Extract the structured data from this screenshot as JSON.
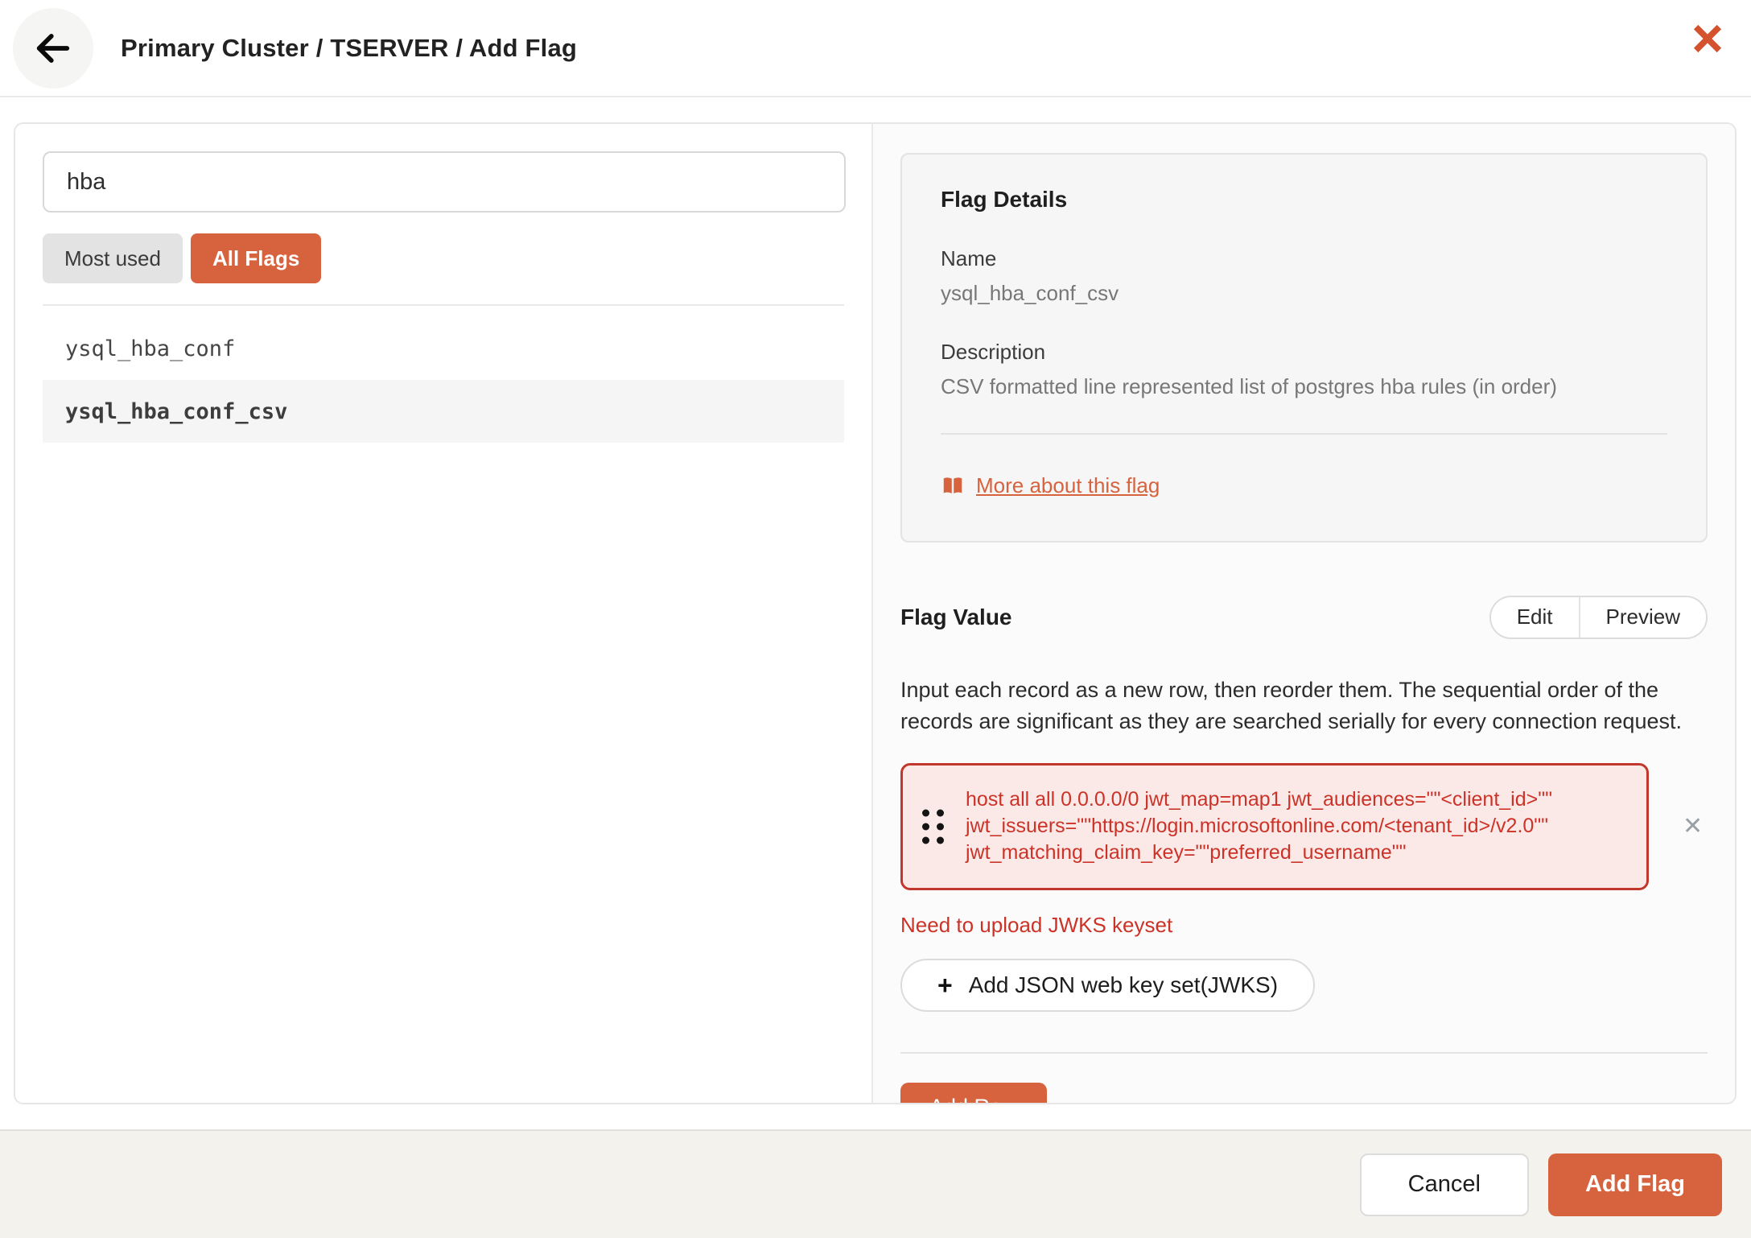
{
  "header": {
    "title": "Primary Cluster / TSERVER / Add Flag"
  },
  "search": {
    "value": "hba"
  },
  "filters": {
    "most_used_label": "Most used",
    "all_flags_label": "All Flags"
  },
  "flag_list": [
    {
      "name": "ysql_hba_conf",
      "selected": false
    },
    {
      "name": "ysql_hba_conf_csv",
      "selected": true
    }
  ],
  "flag_details": {
    "title": "Flag Details",
    "name_label": "Name",
    "name_value": "ysql_hba_conf_csv",
    "description_label": "Description",
    "description_value": "CSV formatted line represented list of postgres hba rules (in order)",
    "more_link_label": "More about this flag"
  },
  "flag_value": {
    "title": "Flag Value",
    "edit_label": "Edit",
    "preview_label": "Preview",
    "instructions": "Input each record as a new row, then reorder them. The sequential order of the records are significant as they are searched serially for every connection request.",
    "row_value": "host all all 0.0.0.0/0 jwt_map=map1 jwt_audiences=\"\"<client_id>\"\" jwt_issuers=\"\"https://login.microsoftonline.com/<tenant_id>/v2.0\"\" jwt_matching_claim_key=\"\"preferred_username\"\"",
    "row_error": "Need to upload JWKS keyset",
    "jwks_button_label": "Add JSON web key set(JWKS)",
    "add_row_label": "Add Row"
  },
  "footer": {
    "cancel_label": "Cancel",
    "submit_label": "Add Flag"
  },
  "colors": {
    "accent": "#D6623E",
    "error_text": "#CC3328",
    "error_border": "#C2372B",
    "error_bg": "#FBE9E8",
    "footer_bg": "#F4F2ED"
  }
}
